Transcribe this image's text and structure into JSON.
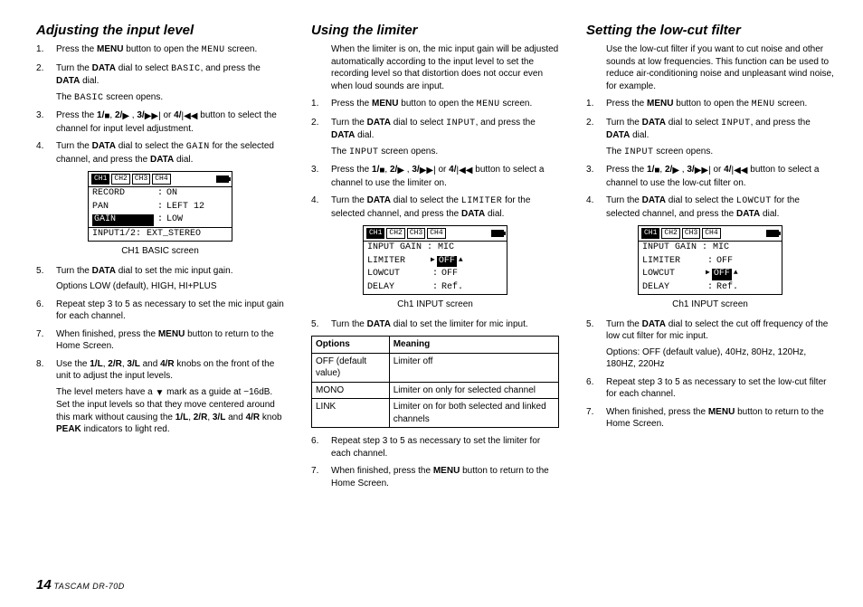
{
  "footer": {
    "page": "14",
    "model": "TASCAM DR-70D"
  },
  "icons": {
    "stop": "■",
    "play": "▶",
    "ffwd": "▶▶|",
    "rew": "|◀◀",
    "down": "▼"
  },
  "col1": {
    "heading": "Adjusting the input level",
    "s1a": "Press the ",
    "s1b": "MENU",
    "s1c": " button to open the ",
    "s1d": "MENU",
    "s1e": " screen.",
    "s2a": "Turn the ",
    "s2b": "DATA",
    "s2c": " dial to select ",
    "s2d": "BASIC",
    "s2e": ", and press the ",
    "s2f": "DATA",
    "s2g": " dial.",
    "s2h": "The ",
    "s2i": "BASIC",
    "s2j": " screen opens.",
    "s3a": "Press the ",
    "s3b": "1/",
    "s3c": ", ",
    "s3d": "2/",
    "s3e": " , ",
    "s3f": "3/",
    "s3g": " or ",
    "s3h": "4/",
    "s3i": " button to select the channel for input level adjustment.",
    "s4a": "Turn the ",
    "s4b": "DATA",
    "s4c": " dial to select the ",
    "s4d": "GAIN",
    "s4e": " for the selected channel, and press the ",
    "s4f": "DATA",
    "s4g": " dial.",
    "lcd": {
      "tabs": [
        "CH1",
        "CH2",
        "CH3",
        "CH4"
      ],
      "r1l": "RECORD",
      "r1v": "ON",
      "r2l": "PAN",
      "r2v": "LEFT 12",
      "r3l": "GAIN",
      "r3v": "LOW",
      "r4": "INPUT1/2: EXT_STEREO"
    },
    "caption": "CH1 BASIC screen",
    "s5a": "Turn the ",
    "s5b": "DATA",
    "s5c": " dial to set the mic input gain.",
    "s5d": "Options LOW (default), HIGH, HI+PLUS",
    "s6": "Repeat step 3 to 5 as necessary to set the mic input gain for each channel.",
    "s7a": "When finished, press the ",
    "s7b": "MENU",
    "s7c": " button to return to the Home Screen.",
    "s8a": "Use the ",
    "s8b": "1/L",
    "s8c": ", ",
    "s8d": "2/R",
    "s8e": ", ",
    "s8f": "3/L",
    "s8g": " and ",
    "s8h": "4/R",
    "s8i": " knobs on the front of the unit to adjust the input levels.",
    "s8j": "The level meters have a ",
    "s8k": " mark as a guide at −16dB. Set the input levels so that they move centered around this mark without causing the ",
    "s8l": "1/L",
    "s8m": ", ",
    "s8n": "2/R",
    "s8o": ", ",
    "s8p": "3/L",
    "s8q": " and ",
    "s8r": "4/R",
    "s8s": " knob ",
    "s8t": "PEAK",
    "s8u": " indicators to light red."
  },
  "col2": {
    "heading": "Using the limiter",
    "intro": "When the limiter is on, the mic input gain will be adjusted automatically according to the input level to set the recording level so that distortion does not occur even when loud sounds are input.",
    "s1a": "Press the ",
    "s1b": "MENU",
    "s1c": " button to open the ",
    "s1d": "MENU",
    "s1e": " screen.",
    "s2a": "Turn the ",
    "s2b": "DATA",
    "s2c": " dial to select ",
    "s2d": "INPUT",
    "s2e": ", and press the ",
    "s2f": "DATA",
    "s2g": " dial.",
    "s2h": "The ",
    "s2i": "INPUT",
    "s2j": " screen opens.",
    "s3a": "Press the ",
    "s3b": "1/",
    "s3c": ", ",
    "s3d": "2/",
    "s3e": " , ",
    "s3f": "3/",
    "s3g": " or ",
    "s3h": "4/",
    "s3i": " button to select a channel to use the limiter on.",
    "s4a": "Turn the ",
    "s4b": "DATA",
    "s4c": " dial to select the ",
    "s4d": "LIMITER",
    "s4e": " for the selected channel, and press the ",
    "s4f": "DATA",
    "s4g": " dial.",
    "lcd": {
      "tabs": [
        "CH1",
        "CH2",
        "CH3",
        "CH4"
      ],
      "r1": "INPUT GAIN : MIC",
      "r2l": "LIMITER",
      "r2v": "OFF",
      "r3l": "LOWCUT",
      "r3v": "OFF",
      "r4l": "DELAY",
      "r4v": "Ref."
    },
    "caption": "Ch1 INPUT screen",
    "s5a": "Turn the ",
    "s5b": "DATA",
    "s5c": " dial to set the limiter for mic input.",
    "table": {
      "h1": "Options",
      "h2": "Meaning",
      "r1o": "OFF (default value)",
      "r1m": "Limiter off",
      "r2o": "MONO",
      "r2m": "Limiter on only for selected channel",
      "r3o": "LINK",
      "r3m": "Limiter on for both selected and linked channels"
    },
    "s6": "Repeat step 3 to 5 as necessary to set the limiter for each channel.",
    "s7a": "When finished, press the ",
    "s7b": "MENU",
    "s7c": " button to return to the Home Screen."
  },
  "col3": {
    "heading": "Setting the low-cut filter",
    "intro": "Use the low-cut filter if you want to cut noise and other sounds at low frequencies. This function can be used to reduce air-conditioning noise and unpleasant wind noise, for example.",
    "s1a": "Press the ",
    "s1b": "MENU",
    "s1c": " button to open the ",
    "s1d": "MENU",
    "s1e": " screen.",
    "s2a": "Turn the ",
    "s2b": "DATA",
    "s2c": " dial to select ",
    "s2d": "INPUT",
    "s2e": ", and press the ",
    "s2f": "DATA",
    "s2g": " dial.",
    "s2h": "The ",
    "s2i": "INPUT",
    "s2j": " screen opens.",
    "s3a": "Press the ",
    "s3b": "1/",
    "s3c": ", ",
    "s3d": "2/",
    "s3e": " , ",
    "s3f": "3/",
    "s3g": " or ",
    "s3h": "4/",
    "s3i": " button to select a channel to use the low-cut filter on.",
    "s4a": "Turn the ",
    "s4b": "DATA",
    "s4c": " dial to select the ",
    "s4d": "LOWCUT",
    "s4e": " for the selected channel, and press the ",
    "s4f": "DATA",
    "s4g": " dial.",
    "lcd": {
      "tabs": [
        "CH1",
        "CH2",
        "CH3",
        "CH4"
      ],
      "r1": "INPUT GAIN : MIC",
      "r2l": "LIMITER",
      "r2v": "OFF",
      "r3l": "LOWCUT",
      "r3v": "OFF",
      "r4l": "DELAY",
      "r4v": "Ref."
    },
    "caption": "Ch1 INPUT screen",
    "s5a": "Turn the ",
    "s5b": "DATA",
    "s5c": " dial to select the cut off frequency of the low cut filter for mic input.",
    "s5d": "Options: OFF (default value), 40Hz, 80Hz, 120Hz, 180HZ, 220Hz",
    "s6": "Repeat step 3 to 5 as necessary to set the low-cut filter for each channel.",
    "s7a": "When finished, press the ",
    "s7b": "MENU",
    "s7c": " button to return to the Home Screen."
  }
}
